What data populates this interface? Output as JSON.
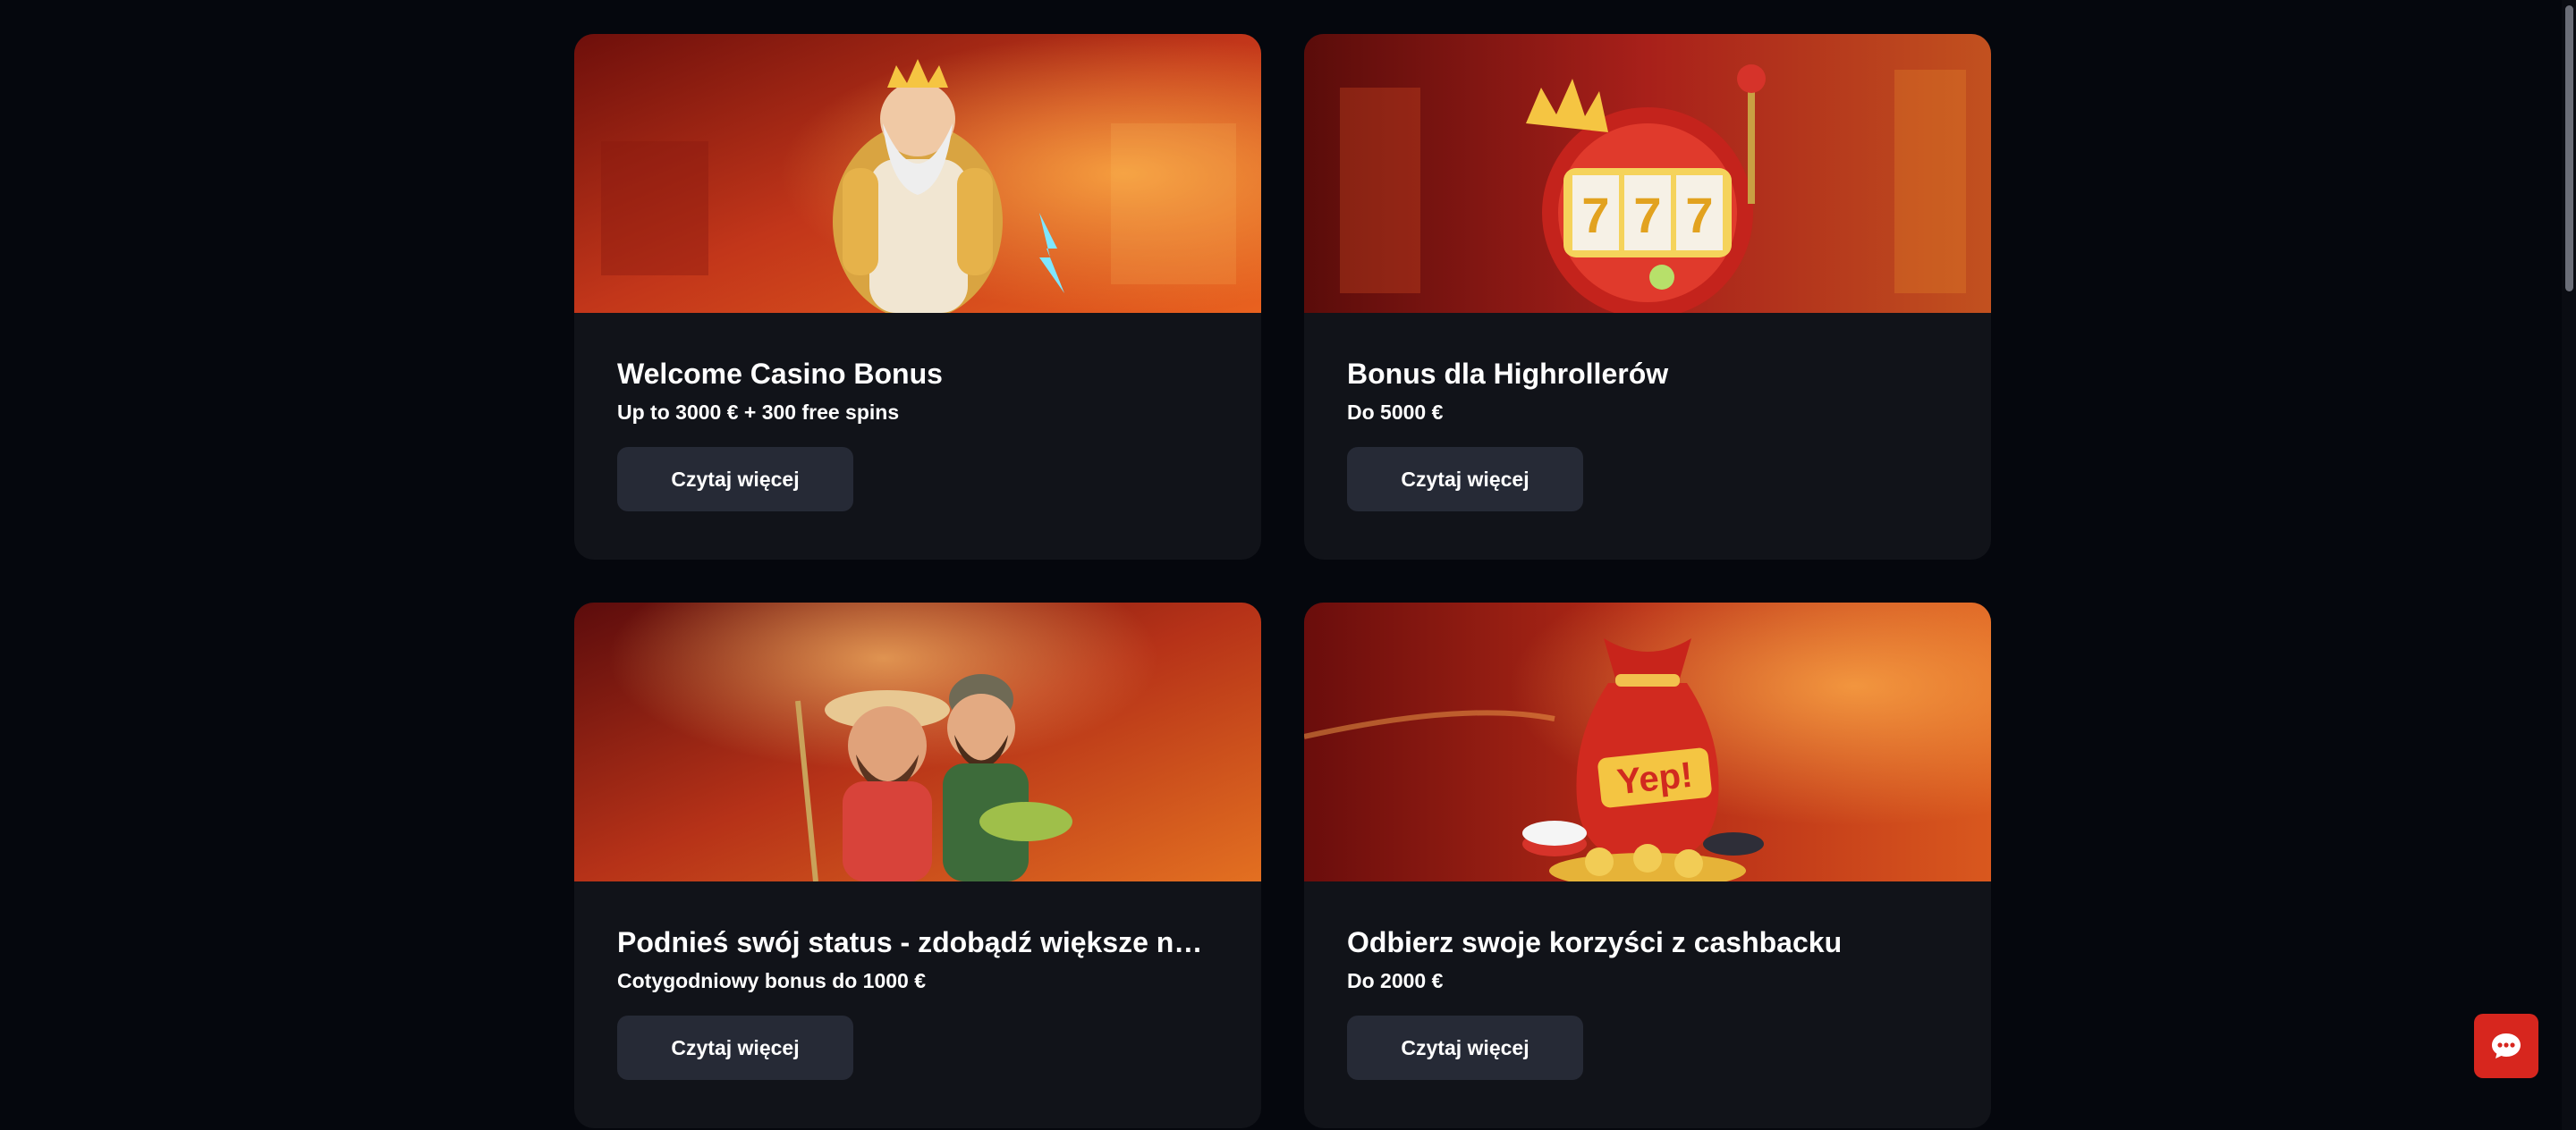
{
  "promotions": [
    {
      "title": "Welcome Casino Bonus",
      "subtitle": "Up to 3000 € + 300 free spins",
      "button_label": "Czytaj więcej",
      "banner_icon": "zeus-character-banner"
    },
    {
      "title": "Bonus dla Highrollerów",
      "subtitle": "Do 5000 €",
      "button_label": "Czytaj więcej",
      "banner_icon": "slot-machine-777-banner"
    },
    {
      "title": "Podnieś swój status - zdobądź większe nagrody",
      "subtitle": "Cotygodniowy bonus do 1000 €",
      "button_label": "Czytaj więcej",
      "banner_icon": "fishermen-characters-banner"
    },
    {
      "title": "Odbierz swoje korzyści z cashbacku",
      "subtitle": "Do 2000 €",
      "button_label": "Czytaj więcej",
      "banner_icon": "money-bag-banner",
      "banner_text": "Yep!"
    }
  ],
  "chat": {
    "icon": "chat-bubble-icon"
  },
  "colors": {
    "background": "#05070d",
    "card": "#111319",
    "button": "#262a36",
    "chat_button": "#d7261e"
  }
}
